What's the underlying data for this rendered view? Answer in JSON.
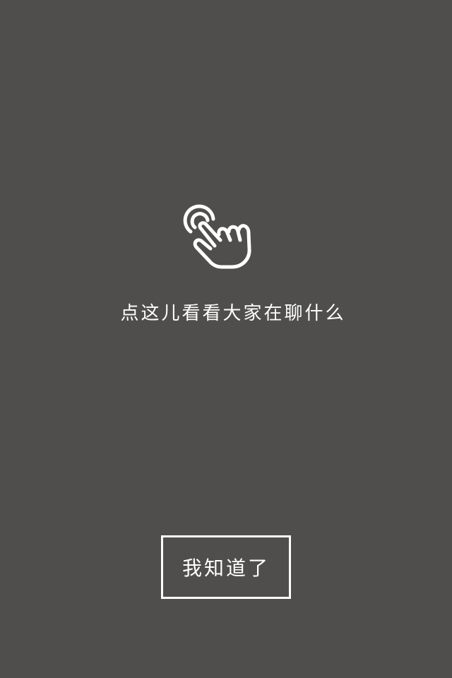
{
  "guide": {
    "icon": "tap-hand-icon",
    "hint_text": "点这儿看看大家在聊什么",
    "dismiss_label": "我知道了"
  },
  "colors": {
    "overlay_background": "#4f4e4d",
    "foreground": "#ffffff"
  }
}
